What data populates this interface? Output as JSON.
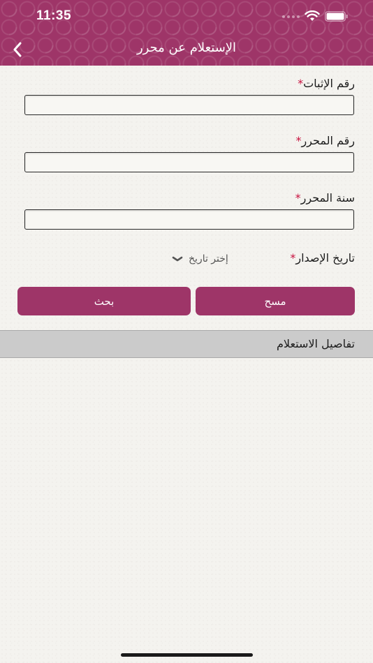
{
  "status_bar": {
    "time": "11:35"
  },
  "nav": {
    "title": "الإستعلام عن محرر",
    "back_icon": "chevron-left-icon"
  },
  "form": {
    "proof_number": {
      "label": "رقم الإثبات",
      "required_mark": "*",
      "value": ""
    },
    "record_number": {
      "label": "رقم المحرر",
      "required_mark": "*",
      "value": ""
    },
    "record_year": {
      "label": "سنة المحرر",
      "required_mark": "*",
      "value": ""
    },
    "issue_date": {
      "label": "تاريخ الإصدار",
      "required_mark": "*",
      "placeholder": "إختر تاريخ"
    }
  },
  "buttons": {
    "clear": "مسح",
    "search": "بحث"
  },
  "details": {
    "title": "تفاصيل الاستعلام"
  },
  "colors": {
    "brand": "#9e3568",
    "required": "#c8103e",
    "section_header": "#cbcbcb",
    "background": "#f4f3ef"
  }
}
